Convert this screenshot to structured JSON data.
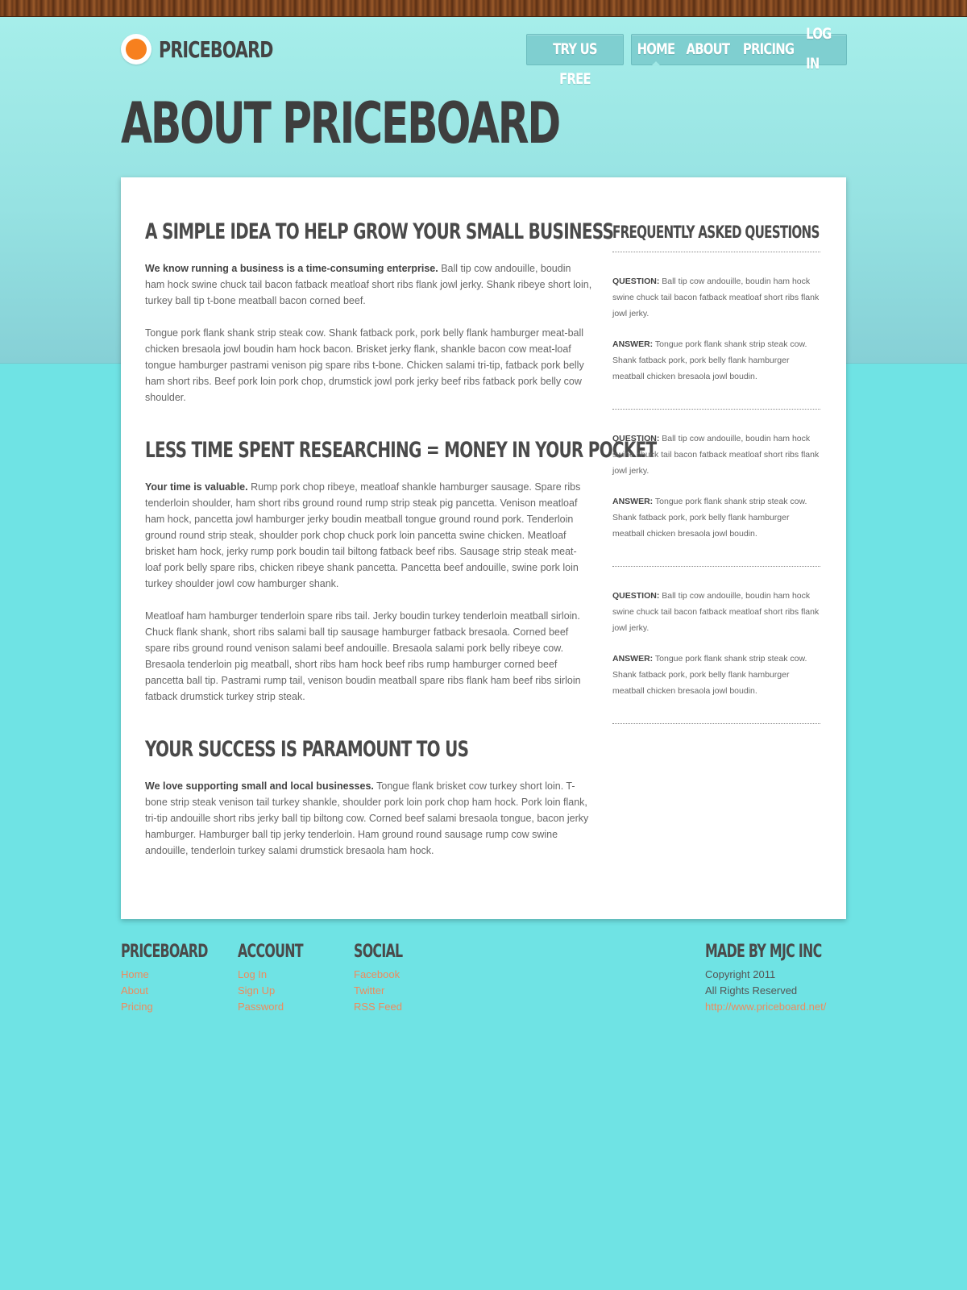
{
  "header": {
    "logo_text": "PRICEBOARD",
    "cta_label": "TRY US FREE",
    "nav": [
      "HOME",
      "ABOUT",
      "PRICING",
      "LOG IN"
    ],
    "active_nav": "HOME"
  },
  "page_title": "ABOUT PRICEBOARD",
  "main": {
    "sections": [
      {
        "heading": "A SIMPLE IDEA TO HELP GROW YOUR SMALL BUSINESS",
        "p1_bold": "We know running a business is a time-consuming enterprise.",
        "p1_text": " Ball tip cow andouille, boudin ham hock swine chuck tail bacon fatback meatloaf short ribs flank jowl jerky. Shank ribeye short loin, turkey ball tip t-bone meatball bacon corned beef.",
        "p2_text": "Tongue pork flank shank strip steak cow. Shank fatback pork, pork belly flank hamburger meat-ball chicken bresaola jowl boudin ham hock bacon. Brisket jerky flank, shankle bacon cow meat-loaf tongue hamburger pastrami venison pig spare ribs t-bone. Chicken salami tri-tip, fatback pork belly ham short ribs. Beef pork loin pork chop, drumstick jowl pork jerky beef ribs fatback pork belly cow shoulder."
      },
      {
        "heading": "LESS TIME SPENT RESEARCHING = MONEY IN YOUR POCKET",
        "p1_bold": "Your time is valuable.",
        "p1_text": " Rump pork chop ribeye, meatloaf shankle hamburger sausage. Spare ribs tenderloin shoulder, ham short ribs ground round rump strip steak pig pancetta. Venison meatloaf ham hock, pancetta jowl hamburger jerky boudin meatball tongue ground round pork. Tenderloin ground round strip steak, shoulder pork chop chuck pork loin pancetta swine chicken. Meatloaf brisket ham hock, jerky rump pork boudin tail biltong fatback beef ribs. Sausage strip steak meat-loaf pork belly spare ribs, chicken ribeye shank pancetta. Pancetta beef andouille, swine pork loin turkey shoulder jowl cow hamburger shank.",
        "p2_text": "Meatloaf ham hamburger tenderloin spare ribs tail. Jerky boudin turkey tenderloin meatball sirloin. Chuck flank shank, short ribs salami ball tip sausage hamburger fatback bresaola. Corned beef spare ribs ground round venison salami beef andouille. Bresaola salami pork belly ribeye cow. Bresaola tenderloin pig meatball, short ribs ham hock beef ribs rump hamburger corned beef pancetta ball tip. Pastrami rump tail, venison boudin meatball spare ribs flank ham beef ribs sirloin fatback drumstick turkey strip steak."
      },
      {
        "heading": "YOUR SUCCESS IS PARAMOUNT TO US",
        "p1_bold": "We love supporting small and local businesses.",
        "p1_text": " Tongue flank brisket cow turkey short loin. T-bone strip steak venison tail turkey shankle, shoulder pork loin pork chop ham hock. Pork loin flank, tri-tip andouille short ribs jerky ball tip biltong cow. Corned beef salami bresaola tongue, bacon jerky hamburger. Hamburger ball tip jerky tenderloin. Ham ground round sausage rump cow swine andouille, tenderloin turkey salami drumstick bresaola ham hock."
      }
    ]
  },
  "faq": {
    "heading": "FREQUENTLY ASKED QUESTIONS",
    "q_label": "QUESTION:",
    "a_label": "ANSWER:",
    "items": [
      {
        "question": " Ball tip cow andouille, boudin ham hock swine chuck tail bacon fatback meatloaf short ribs flank jowl jerky.",
        "answer": " Tongue pork flank shank strip steak cow. Shank fatback pork, pork belly flank hamburger meatball chicken bresaola jowl boudin."
      },
      {
        "question": " Ball tip cow andouille, boudin ham hock swine chuck tail bacon fatback meatloaf short ribs flank jowl jerky.",
        "answer": " Tongue pork flank shank strip steak cow. Shank fatback pork, pork belly flank hamburger meatball chicken bresaola jowl boudin."
      },
      {
        "question": " Ball tip cow andouille, boudin ham hock swine chuck tail bacon fatback meatloaf short ribs flank jowl jerky.",
        "answer": " Tongue pork flank shank strip steak cow. Shank fatback pork, pork belly flank hamburger meatball chicken bresaola jowl boudin."
      }
    ]
  },
  "footer": {
    "priceboard": {
      "heading": "PRICEBOARD",
      "links": [
        "Home",
        "About",
        "Pricing"
      ]
    },
    "account": {
      "heading": "ACCOUNT",
      "links": [
        "Log In",
        "Sign Up",
        "Password"
      ]
    },
    "social": {
      "heading": "SOCIAL",
      "links": [
        "Facebook",
        "Twitter",
        "RSS Feed"
      ]
    },
    "made_by": {
      "heading": "MADE BY MJC INC",
      "copyright": "Copyright 2011",
      "rights": "All Rights Reserved",
      "url": "http://www.priceboard.net/"
    }
  },
  "colors": {
    "background": "#6fe3e4",
    "logo_orange": "#f7801e",
    "link": "#ef8a5c",
    "heading": "#4a4a4a"
  }
}
